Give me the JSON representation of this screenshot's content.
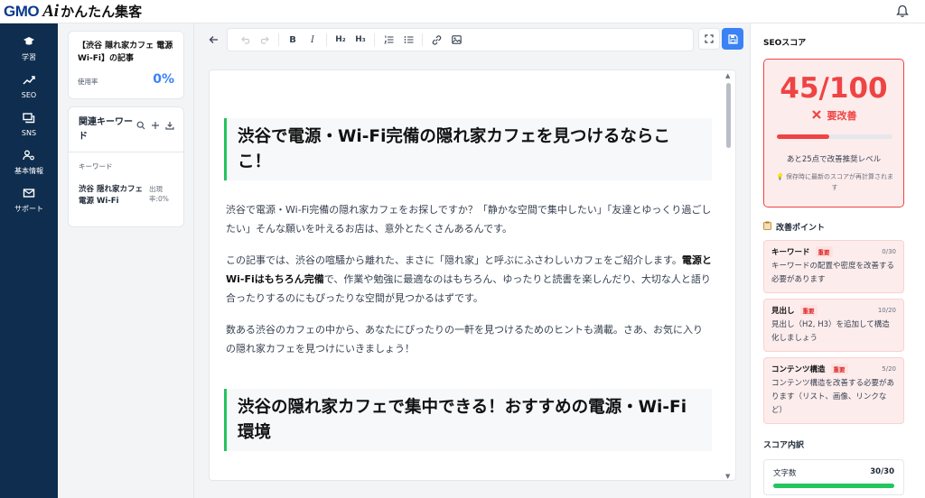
{
  "brand": {
    "gmo": "GMO",
    "ai": "Ai",
    "rest": "かんたん集客"
  },
  "nav": [
    {
      "label": "学習",
      "icon": "graduation-cap-icon"
    },
    {
      "label": "SEO",
      "icon": "trend-chart-icon"
    },
    {
      "label": "SNS",
      "icon": "chat-icon"
    },
    {
      "label": "基本情報",
      "icon": "user-settings-icon"
    },
    {
      "label": "サポート",
      "icon": "mail-icon"
    }
  ],
  "article": {
    "title": "【渋谷 隠れ家カフェ 電源 Wi-Fi】の記事",
    "usage_label": "使用率",
    "usage_value": "0%"
  },
  "keywords": {
    "title": "関連キーワード",
    "column": "キーワード",
    "items": [
      {
        "name": "渋谷 隠れ家カフェ 電源 Wi-Fi",
        "rate": "出現率:0%"
      }
    ]
  },
  "editor": {
    "heading1": "渋谷で電源・Wi-Fi完備の隠れ家カフェを見つけるならここ！",
    "p1": "渋谷で電源・Wi-Fi完備の隠れ家カフェをお探しですか？「静かな空間で集中したい」「友達とゆっくり過ごしたい」そんな願いを叶えるお店は、意外とたくさんあるんです。",
    "p2_a": "この記事では、渋谷の喧騒から離れた、まさに「隠れ家」と呼ぶにふさわしいカフェをご紹介します。",
    "p2_b": "電源とWi-Fiはもちろん完備",
    "p2_c": "で、作業や勉強に最適なのはもちろん、ゆったりと読書を楽しんだり、大切な人と語り合ったりするのにもぴったりな空間が見つかるはずです。",
    "p3": "数ある渋谷のカフェの中から、あなたにぴったりの一軒を見つけるためのヒントも満載。さあ、お気に入りの隠れ家カフェを見つけにいきましょう！",
    "heading2": "渋谷の隠れ家カフェで集中できる！おすすめの電源・Wi-Fi環境",
    "toolbar": {
      "h2": "H₂",
      "h3": "H₃"
    }
  },
  "seo": {
    "title": "SEOスコア",
    "score": "45/100",
    "score_fraction": 0.45,
    "status": "要改善",
    "next": "あと25点で改善推奨レベル",
    "note": "💡 保存時に最新のスコアが再計算されます",
    "points_title": "改善ポイント",
    "points": [
      {
        "name": "キーワード",
        "badge": "重要",
        "score": "0/30",
        "desc": "キーワードの配置や密度を改善する必要があります"
      },
      {
        "name": "見出し",
        "badge": "重要",
        "score": "10/20",
        "desc": "見出し（H2, H3）を追加して構造化しましょう"
      },
      {
        "name": "コンテンツ構造",
        "badge": "重要",
        "score": "5/20",
        "desc": "コンテンツ構造を改善する必要があります（リスト、画像、リンクなど）"
      }
    ],
    "breakdown_title": "スコア内訳",
    "breakdown": [
      {
        "name": "文字数",
        "value": "30/30",
        "fraction": 1.0
      }
    ]
  },
  "colors": {
    "nav_bg": "#0f2d4e",
    "accent": "#3b82f6",
    "danger": "#ef4444",
    "success": "#22c55e"
  }
}
